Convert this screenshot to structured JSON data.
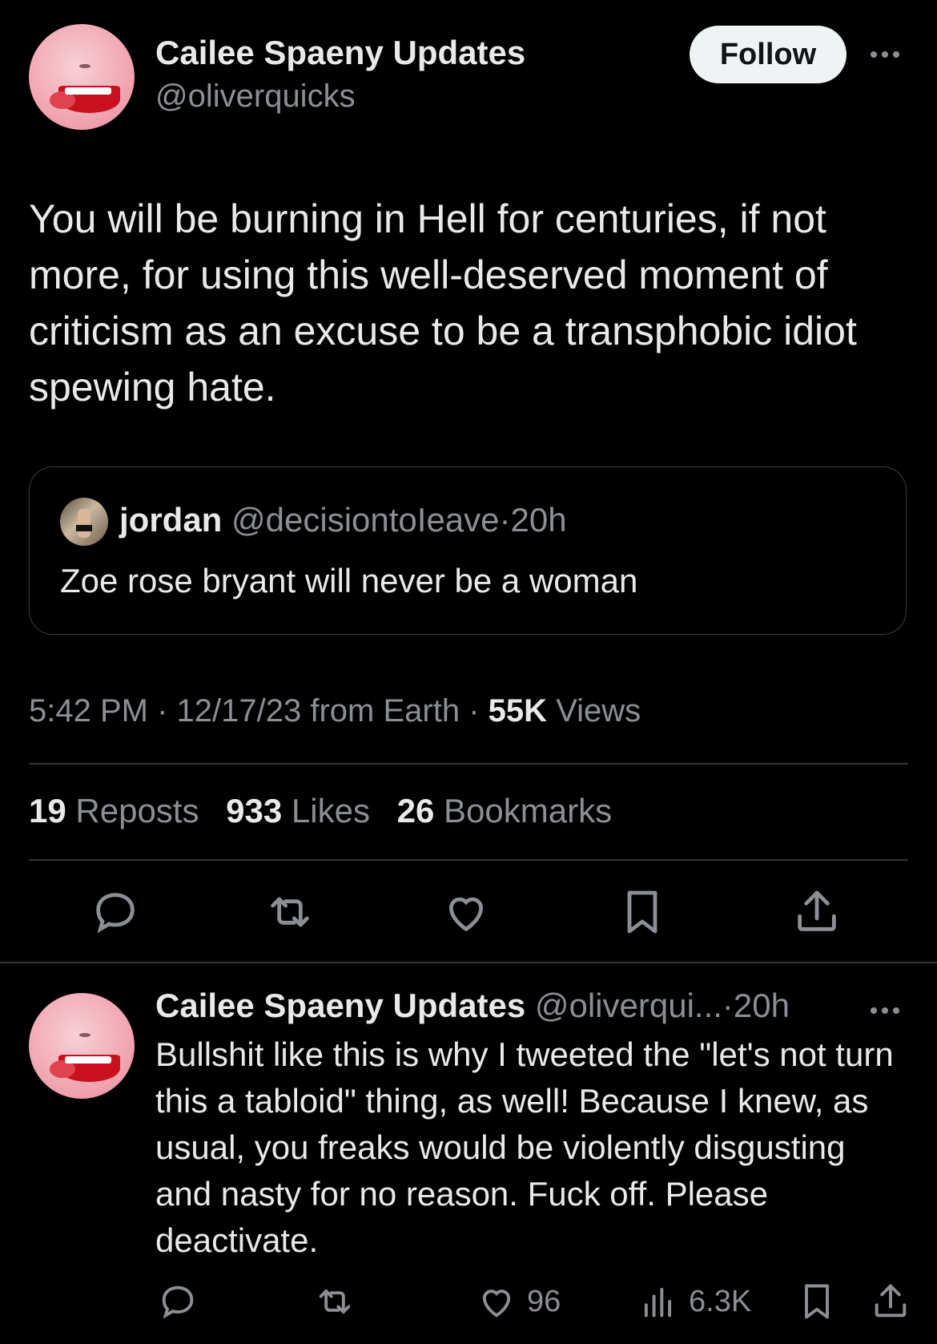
{
  "main_tweet": {
    "author_name": "Cailee Spaeny Updates",
    "author_handle": "@oliverquicks",
    "follow_label": "Follow",
    "text": "You will be burning in Hell for centuries, if not more, for using this well-deserved moment of criticism as an excuse to be a transphobic idiot spewing hate.",
    "quoted": {
      "name": "jordan",
      "handle": "@decisiontoIeave",
      "separator": "·",
      "time": "20h",
      "text": "Zoe rose bryant will never be a woman"
    },
    "meta": {
      "time": "5:42 PM",
      "separator": "·",
      "date_source": "12/17/23 from Earth",
      "views_count": "55K",
      "views_label": "Views"
    },
    "stats": {
      "reposts_count": "19",
      "reposts_label": "Reposts",
      "likes_count": "933",
      "likes_label": "Likes",
      "bookmarks_count": "26",
      "bookmarks_label": "Bookmarks"
    },
    "actions": [
      "reply-icon",
      "repost-icon",
      "like-icon",
      "bookmark-icon",
      "share-icon"
    ]
  },
  "reply_tweet": {
    "author_name": "Cailee Spaeny Updates",
    "author_handle": "@oliverqui...",
    "separator": "·",
    "time": "20h",
    "text": "Bullshit like this is why I tweeted the \"let's not turn this a tabloid\" thing, as well! Because I knew, as usual, you freaks would be violently disgusting and nasty for no reason. Fuck off. Please deactivate.",
    "likes_count": "96",
    "views_count": "6.3K"
  },
  "colors": {
    "background": "#000000",
    "text_primary": "#e7e9ea",
    "text_secondary": "#8b8f94",
    "follow_button_bg": "#eff3f4",
    "border": "#2f3336"
  }
}
